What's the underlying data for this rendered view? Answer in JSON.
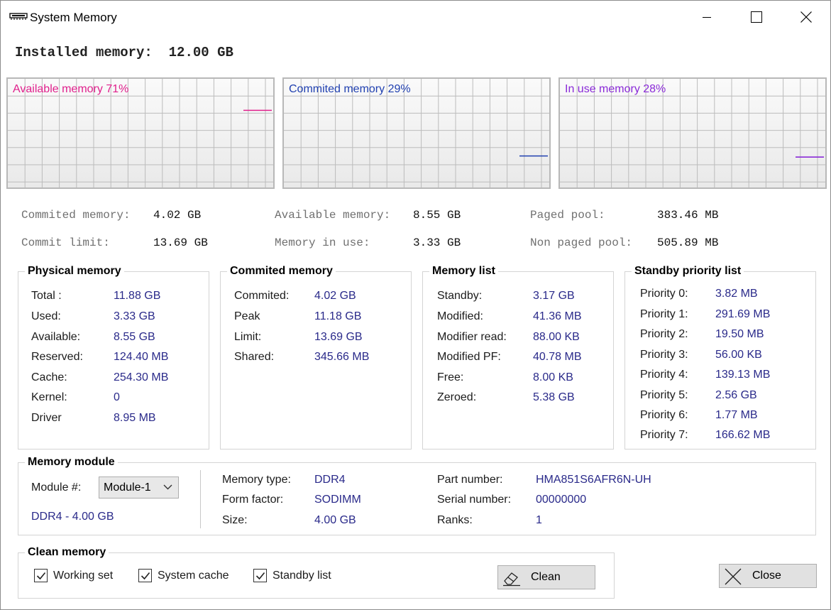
{
  "window": {
    "title": "System Memory",
    "controls": {
      "minimize": "minimize-icon",
      "maximize": "maximize-icon",
      "close": "close-icon"
    }
  },
  "installed": {
    "label": "Installed memory:",
    "value": "12.00 GB"
  },
  "graphs": [
    {
      "label": "Available memory 71%",
      "percent": 71,
      "color": "#e0208c"
    },
    {
      "label": "Commited memory 29%",
      "percent": 29,
      "color": "#2040b0"
    },
    {
      "label": "In use memory 28%",
      "percent": 28,
      "color": "#8a2ad8"
    }
  ],
  "stats": {
    "commited_memory": {
      "label": "Commited memory:",
      "value": "4.02 GB"
    },
    "commit_limit": {
      "label": "Commit limit:",
      "value": "13.69 GB"
    },
    "available_memory": {
      "label": "Available memory:",
      "value": "8.55 GB"
    },
    "memory_in_use": {
      "label": "Memory in use:",
      "value": "3.33 GB"
    },
    "paged_pool": {
      "label": "Paged pool:",
      "value": "383.46 MB"
    },
    "non_paged_pool": {
      "label": "Non paged pool:",
      "value": "505.89 MB"
    }
  },
  "physical": {
    "title": "Physical memory",
    "rows": [
      {
        "label": "Total :",
        "value": "11.88 GB"
      },
      {
        "label": "Used:",
        "value": "3.33 GB"
      },
      {
        "label": "Available:",
        "value": "8.55 GB"
      },
      {
        "label": "Reserved:",
        "value": "124.40 MB"
      },
      {
        "label": "Cache:",
        "value": "254.30 MB"
      },
      {
        "label": "Kernel:",
        "value": "0"
      },
      {
        "label": "Driver",
        "value": "8.95 MB"
      }
    ]
  },
  "commited": {
    "title": "Commited memory",
    "rows": [
      {
        "label": "Commited:",
        "value": "4.02 GB"
      },
      {
        "label": "Peak",
        "value": "11.18 GB"
      },
      {
        "label": "Limit:",
        "value": "13.69 GB"
      },
      {
        "label": "Shared:",
        "value": "345.66 MB"
      }
    ]
  },
  "memlist": {
    "title": "Memory list",
    "rows": [
      {
        "label": "Standby:",
        "value": "3.17 GB"
      },
      {
        "label": "Modified:",
        "value": "41.36 MB"
      },
      {
        "label": "Modifier read:",
        "value": "88.00 KB"
      },
      {
        "label": "Modified PF:",
        "value": "40.78 MB"
      },
      {
        "label": "Free:",
        "value": "8.00 KB"
      },
      {
        "label": "Zeroed:",
        "value": "5.38 GB"
      }
    ]
  },
  "standby": {
    "title": "Standby priority list",
    "rows": [
      {
        "label": "Priority 0:",
        "value": "3.82 MB"
      },
      {
        "label": "Priority 1:",
        "value": "291.69 MB"
      },
      {
        "label": "Priority 2:",
        "value": "19.50 MB"
      },
      {
        "label": "Priority 3:",
        "value": "56.00 KB"
      },
      {
        "label": "Priority 4:",
        "value": "139.13 MB"
      },
      {
        "label": "Priority 5:",
        "value": "2.56 GB"
      },
      {
        "label": "Priority 6:",
        "value": "1.77 MB"
      },
      {
        "label": "Priority 7:",
        "value": "166.62 MB"
      }
    ]
  },
  "module": {
    "title": "Memory module",
    "module_label": "Module #:",
    "selected": "Module-1",
    "summary": "DDR4 - 4.00 GB",
    "memory_type": {
      "label": "Memory type:",
      "value": "DDR4"
    },
    "form_factor": {
      "label": "Form factor:",
      "value": "SODIMM"
    },
    "size": {
      "label": "Size:",
      "value": "4.00 GB"
    },
    "part_number": {
      "label": "Part number:",
      "value": "HMA851S6AFR6N-UH"
    },
    "serial_number": {
      "label": "Serial number:",
      "value": "00000000"
    },
    "ranks": {
      "label": "Ranks:",
      "value": "1"
    }
  },
  "clean": {
    "title": "Clean memory",
    "options": [
      {
        "label": "Working set",
        "checked": true
      },
      {
        "label": "System cache",
        "checked": true
      },
      {
        "label": "Standby list",
        "checked": true
      }
    ],
    "clean_button": "Clean",
    "close_button": "Close"
  }
}
